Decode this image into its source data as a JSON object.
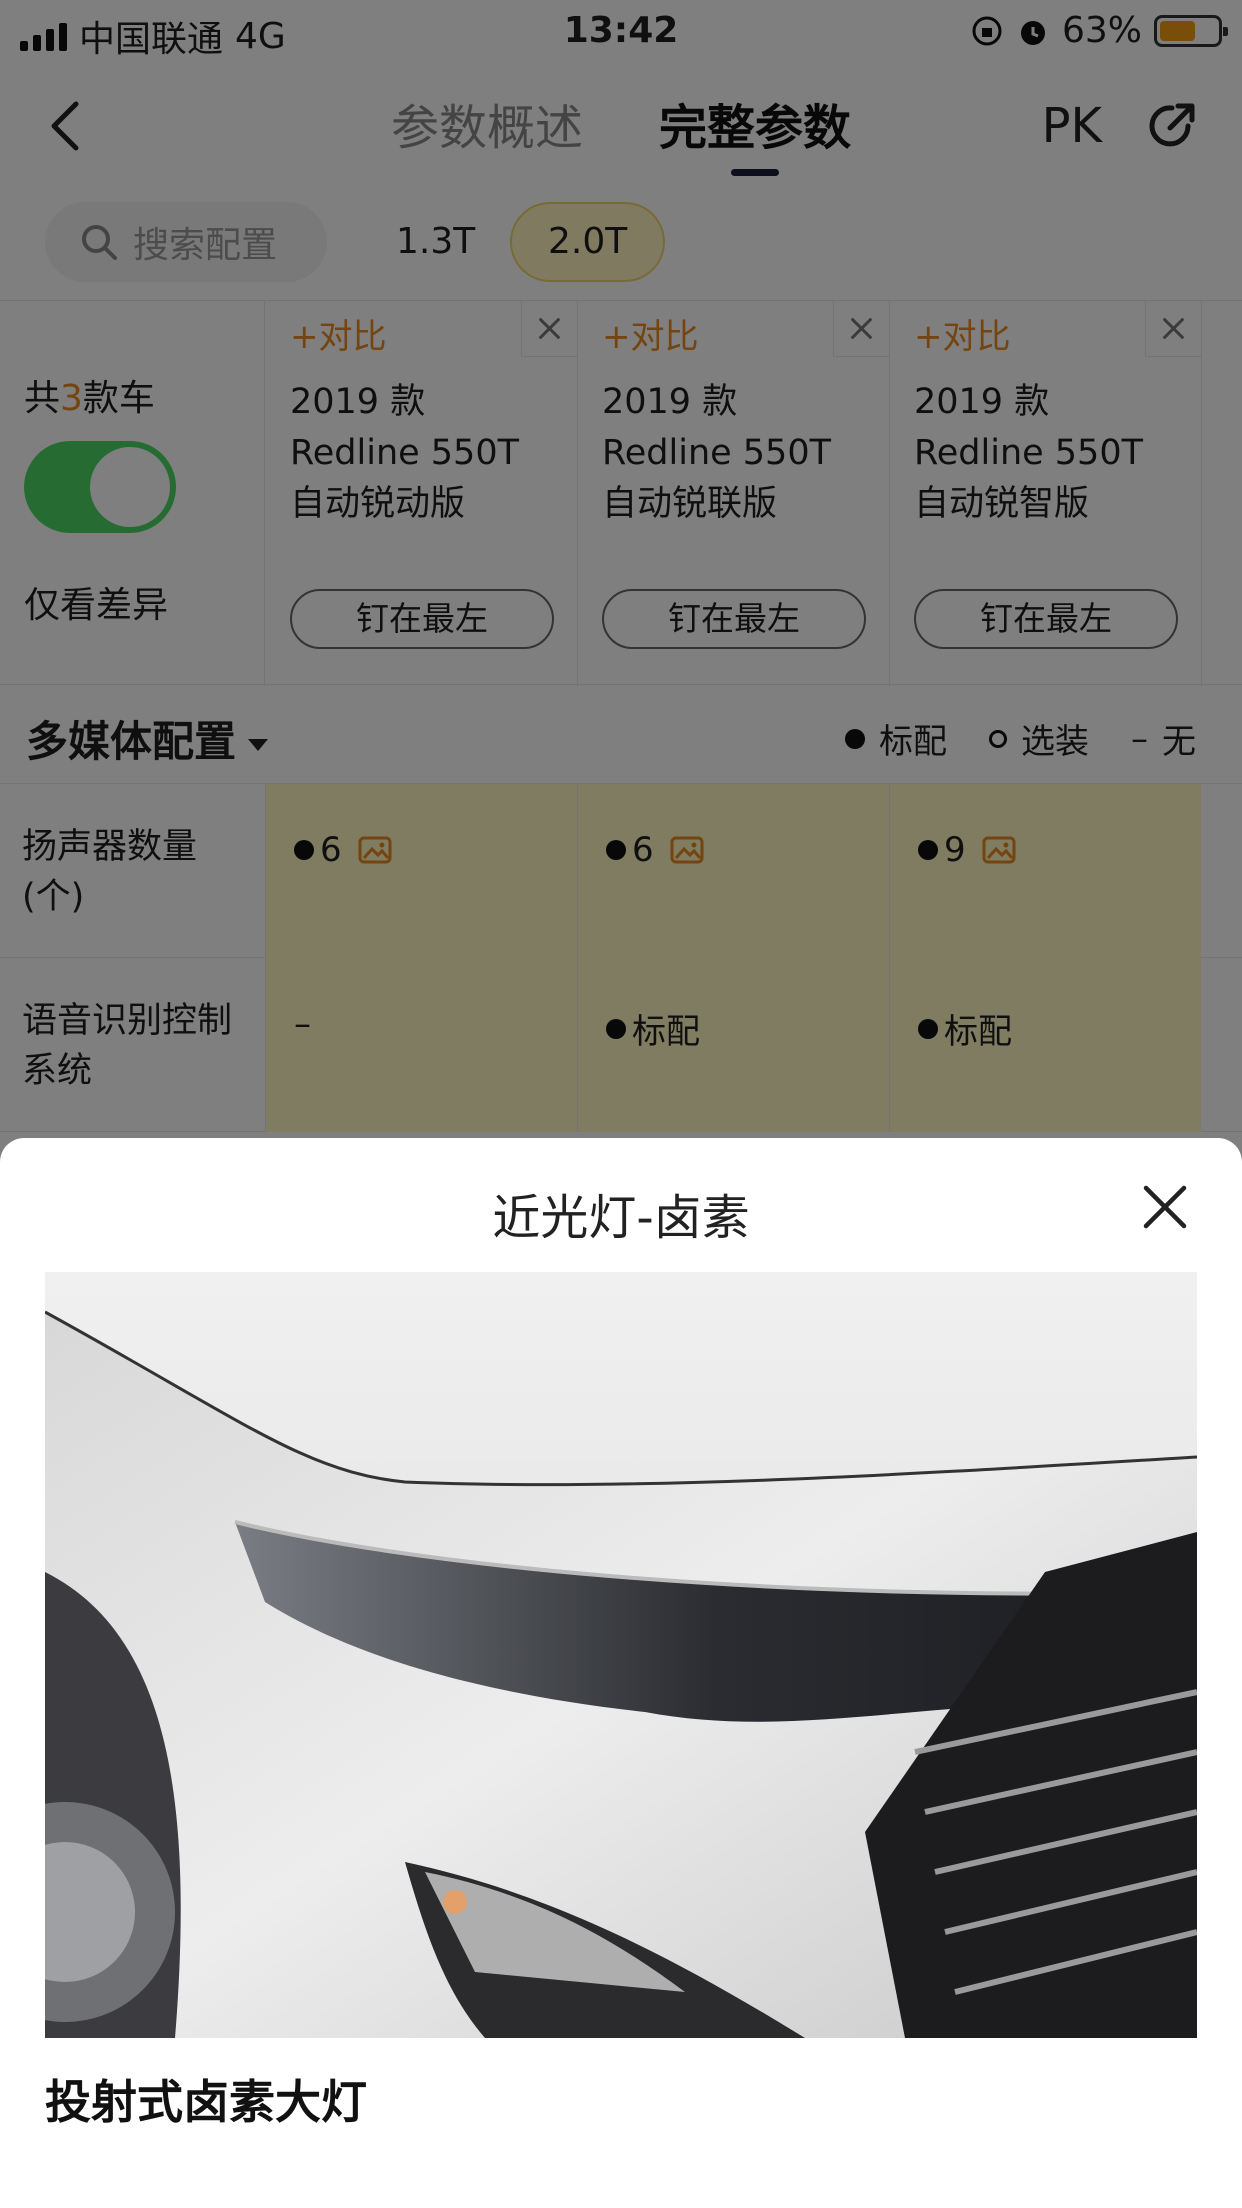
{
  "status_bar": {
    "carrier": "中国联通",
    "network": "4G",
    "time": "13:42",
    "battery_percent": "63%",
    "battery_level": 0.63,
    "battery_color": "#f39c12"
  },
  "nav": {
    "tabs": [
      {
        "label": "参数概述",
        "active": false
      },
      {
        "label": "完整参数",
        "active": true
      }
    ],
    "pk_label": "PK"
  },
  "filters": {
    "search_placeholder": "搜索配置",
    "chips": [
      {
        "label": "1.3T",
        "selected": false
      },
      {
        "label": "2.0T",
        "selected": true
      }
    ]
  },
  "compare": {
    "count_prefix": "共",
    "count": "3",
    "count_suffix": "款车",
    "diff_toggle_on": true,
    "diff_label": "仅看差异",
    "add_label": "+对比",
    "pin_label": "钉在最左",
    "cars": [
      {
        "year": "2019 款",
        "model": "Redline 550T",
        "trim": "自动锐动版"
      },
      {
        "year": "2019 款",
        "model": "Redline 550T",
        "trim": "自动锐联版"
      },
      {
        "year": "2019 款",
        "model": "Redline 550T",
        "trim": "自动锐智版"
      }
    ]
  },
  "section": {
    "title": "多媒体配置",
    "legend": [
      {
        "symbol": "●",
        "label": "标配"
      },
      {
        "symbol": "○",
        "label": "选装"
      },
      {
        "symbol": "–",
        "label": "无"
      }
    ]
  },
  "rows": [
    {
      "label": "扬声器数量(个)",
      "values": [
        {
          "text": "6",
          "dot": true,
          "image": true
        },
        {
          "text": "6",
          "dot": true,
          "image": true
        },
        {
          "text": "9",
          "dot": true,
          "image": true
        }
      ]
    },
    {
      "label": "语音识别控制系统",
      "values": [
        {
          "text": "–",
          "dot": false,
          "image": false
        },
        {
          "text": "标配",
          "dot": true,
          "image": false
        },
        {
          "text": "标配",
          "dot": true,
          "image": false
        }
      ]
    }
  ],
  "sheet": {
    "title": "近光灯-卤素",
    "caption": "投射式卤素大灯"
  },
  "colors": {
    "accent": "#e98a20",
    "toggle_on": "#4cd964",
    "highlight_cell": "#fff8c4",
    "selected_chip": "#fff5c0"
  }
}
